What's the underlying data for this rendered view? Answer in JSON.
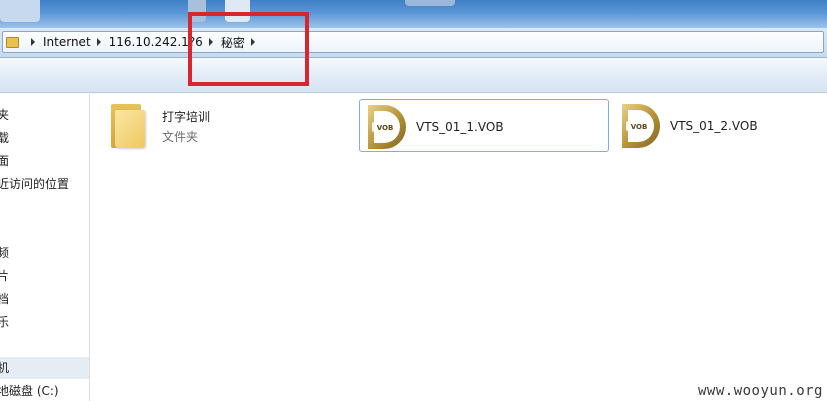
{
  "address_bar": {
    "crumbs": [
      "Internet",
      "116.10.242.1?6",
      "秘密"
    ]
  },
  "nav_pane": {
    "items": [
      {
        "label": "夹"
      },
      {
        "label": "载"
      },
      {
        "label": "面"
      },
      {
        "label": "近访问的位置"
      },
      {
        "label": "频"
      },
      {
        "label": "片"
      },
      {
        "label": "档"
      },
      {
        "label": "乐"
      },
      {
        "label": "机"
      },
      {
        "label": "地磁盘 (C:)"
      }
    ]
  },
  "content": {
    "folder": {
      "name": "打字培训",
      "type": "文件夹"
    },
    "files": [
      {
        "name": "VTS_01_1.VOB",
        "icon_label": "VOB"
      },
      {
        "name": "VTS_01_2.VOB",
        "icon_label": "VOB"
      }
    ]
  },
  "watermark": "www.wooyun.org",
  "colors": {
    "highlight": "#d8262e",
    "accent": "#84acdd",
    "icon_gold": "#b8963a"
  }
}
